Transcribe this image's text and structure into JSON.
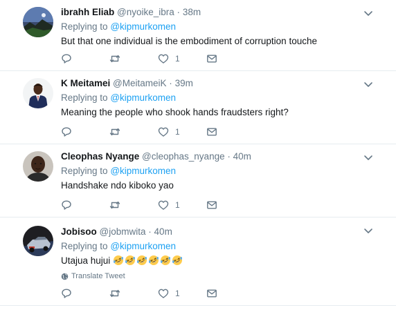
{
  "tweets": [
    {
      "name": "ibrahh Eliab",
      "handle": "@nyoike_ibra",
      "separator": "·",
      "time": "38m",
      "replying_label": "Replying to",
      "replying_to": "@kipmurkomen",
      "text": "But that one individual is the embodiment of corruption touche",
      "likes": "1",
      "avatar_icon": "landscape-avatar-icon"
    },
    {
      "name": "K Meitamei",
      "handle": "@MeitameiK",
      "separator": "·",
      "time": "39m",
      "replying_label": "Replying to",
      "replying_to": "@kipmurkomen",
      "text": "Meaning the people who shook hands fraudsters right?",
      "likes": "1",
      "avatar_icon": "suit-person-avatar-icon"
    },
    {
      "name": "Cleophas Nyange",
      "handle": "@cleophas_nyange",
      "separator": "·",
      "time": "40m",
      "replying_label": "Replying to",
      "replying_to": "@kipmurkomen",
      "text": "Handshake ndo kiboko yao",
      "likes": "1",
      "avatar_icon": "face-avatar-icon"
    },
    {
      "name": "Jobisoo",
      "handle": "@jobmwita",
      "separator": "·",
      "time": "40m",
      "replying_label": "Replying to",
      "replying_to": "@kipmurkomen",
      "text": "Utajua hujui",
      "emoji_count": 6,
      "emoji_icon": "rolling-laughing-emoji",
      "translate_label": "Translate Tweet",
      "likes": "1",
      "avatar_icon": "car-avatar-icon"
    }
  ],
  "colors": {
    "link": "#1da1f2",
    "secondary": "#657786",
    "divider": "#e6ecf0",
    "emoji": "#ffcc4d"
  }
}
